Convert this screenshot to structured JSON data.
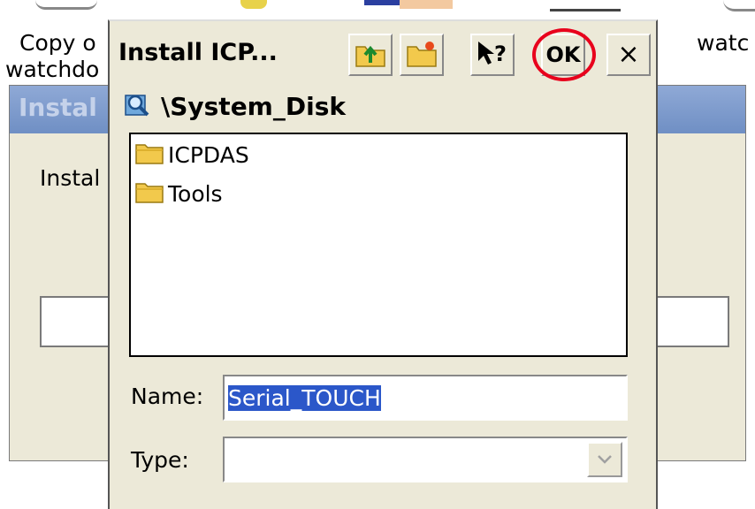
{
  "desktop": {
    "icons": [
      {
        "label": "Copy o",
        "label_line2": "watchdo"
      },
      {
        "label": "watc"
      }
    ]
  },
  "background_dialog": {
    "title": "Instal",
    "body_text": "Instal",
    "input_value": ""
  },
  "dialog": {
    "title": "Install ICP...",
    "toolbar": {
      "up_folder_icon": "folder-up-icon",
      "new_folder_icon": "new-folder-icon",
      "help_icon": "help-arrow-icon",
      "ok_label": "OK",
      "close_label": "×"
    },
    "highlight_color": "#e8001c",
    "path": "\\System_Disk",
    "files": [
      {
        "name": "ICPDAS",
        "icon": "folder-icon"
      },
      {
        "name": "Tools",
        "icon": "folder-icon"
      }
    ],
    "name_label": "Name:",
    "name_value": "Serial_TOUCH",
    "type_label": "Type:",
    "type_value": ""
  }
}
